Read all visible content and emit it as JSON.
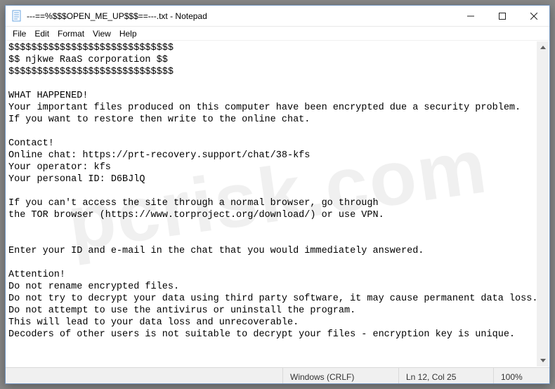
{
  "window": {
    "title": "---==%$$$OPEN_ME_UP$$$==---.txt - Notepad"
  },
  "menu": {
    "file": "File",
    "edit": "Edit",
    "format": "Format",
    "view": "View",
    "help": "Help"
  },
  "content": {
    "lines": [
      "$$$$$$$$$$$$$$$$$$$$$$$$$$$$$",
      "$$ njkwe RaaS corporation $$",
      "$$$$$$$$$$$$$$$$$$$$$$$$$$$$$",
      "",
      "WHAT HAPPENED!",
      "Your important files produced on this computer have been encrypted due a security problem.",
      "If you want to restore then write to the online chat.",
      "",
      "Contact!",
      "Online chat: https://prt-recovery.support/chat/38-kfs",
      "Your operator: kfs",
      "Your personal ID: D6BJlQ",
      "",
      "If you can't access the site through a normal browser, go through",
      "the TOR browser (https://www.torproject.org/download/) or use VPN.",
      "",
      "",
      "Enter your ID and e-mail in the chat that you would immediately answered.",
      "",
      "Attention!",
      "Do not rename encrypted files.",
      "Do not try to decrypt your data using third party software, it may cause permanent data loss.",
      "Do not attempt to use the antivirus or uninstall the program.",
      "This will lead to your data loss and unrecoverable.",
      "Decoders of other users is not suitable to decrypt your files - encryption key is unique."
    ]
  },
  "status": {
    "encoding": "Windows (CRLF)",
    "position": "Ln 12, Col 25",
    "zoom": "100%"
  },
  "watermark": "pcrisk.com"
}
